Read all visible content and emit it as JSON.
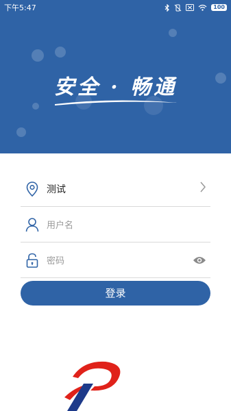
{
  "status_bar": {
    "time": "下午5:47",
    "battery": "100",
    "icons": [
      "bluetooth-icon",
      "vibrate-off-icon",
      "sim-off-icon",
      "wifi-icon",
      "battery-icon"
    ]
  },
  "hero": {
    "slogan": "安全 · 畅通",
    "background_color": "#2f63a6"
  },
  "form": {
    "server": {
      "value": "测试",
      "icon": "location-pin-icon",
      "arrow": "chevron-right-icon"
    },
    "username": {
      "placeholder": "用户名",
      "icon": "user-icon"
    },
    "password": {
      "placeholder": "密码",
      "icon": "lock-icon",
      "toggle": "eye-icon"
    }
  },
  "login_button": {
    "label": "登录"
  },
  "logo": {
    "name": "brand-logo"
  },
  "colors": {
    "accent": "#2f63a6",
    "logo_red": "#e0221a",
    "divider": "#d9d9d9"
  }
}
